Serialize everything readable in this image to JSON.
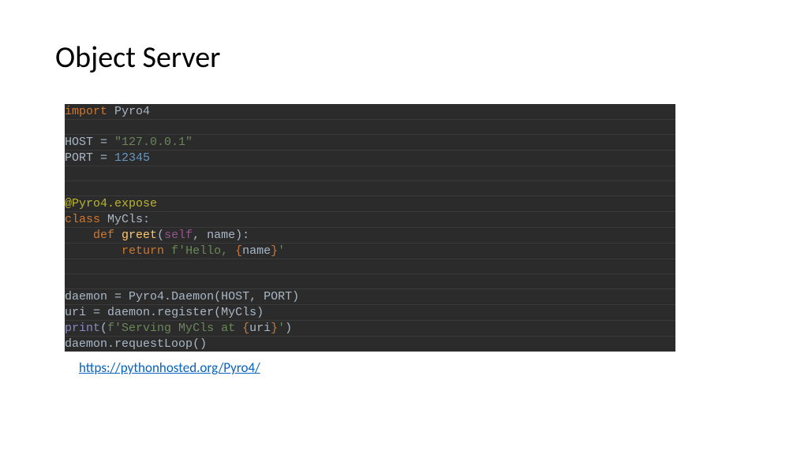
{
  "title": "Object Server",
  "link": {
    "text": "https://pythonhosted.org/Pyro4/",
    "href": "https://pythonhosted.org/Pyro4/"
  },
  "code": {
    "import_kw": "import",
    "import_mod": "Pyro4",
    "host_name": "HOST",
    "eq": " = ",
    "host_val": "\"127.0.0.1\"",
    "port_name": "PORT",
    "port_val": "12345",
    "decorator": "@Pyro4.expose",
    "class_kw": "class",
    "class_name": "MyCls",
    "colon": ":",
    "indent1": "    ",
    "indent2": "        ",
    "def_kw": "def",
    "method_name": "greet",
    "lp": "(",
    "rp": ")",
    "self": "self",
    "comma": ",",
    "sp": " ",
    "param": "name",
    "return_kw": "return",
    "fpre": "f",
    "fstr1": "'Hello, ",
    "lbrace": "{",
    "fvar": "name",
    "rbrace": "}",
    "fstr2": "'",
    "daemon": "daemon",
    "pyro4": "Pyro4",
    "dot": ".",
    "Daemon": "Daemon",
    "HOST": "HOST",
    "PORT": "PORT",
    "uri": "uri",
    "register": "register",
    "MyCls_ref": "MyCls",
    "print": "print",
    "pstr1": "'Serving MyCls at ",
    "pvar": "uri",
    "pstr2": "'",
    "requestLoop": "requestLoop",
    "emptyparen": "()"
  }
}
